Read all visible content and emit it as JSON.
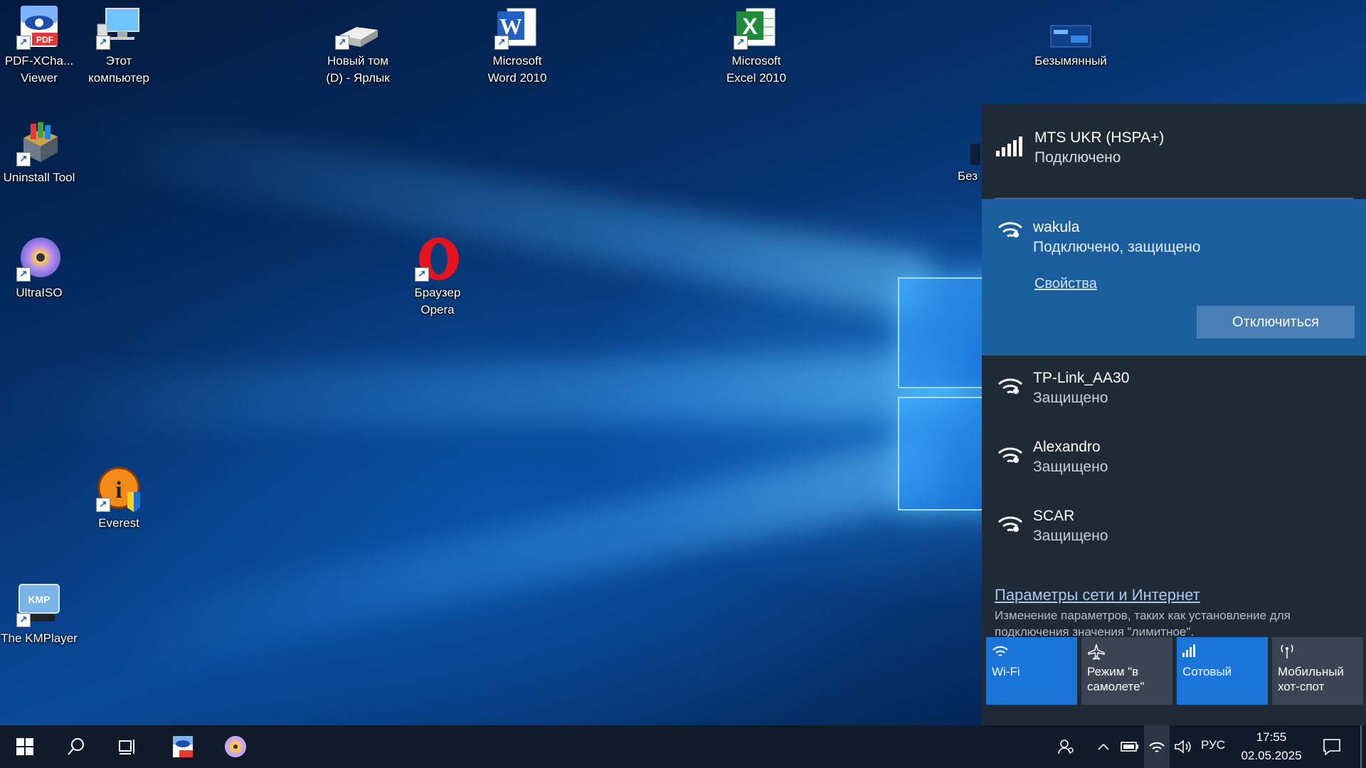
{
  "desktop": {
    "icons": [
      {
        "label": "PDF-XCha...\nViewer",
        "icon": "pdf-viewer-icon"
      },
      {
        "label": "Этот\nкомпьютер",
        "icon": "computer-icon"
      },
      {
        "label": "Новый том\n(D) - Ярлык",
        "icon": "drive-icon"
      },
      {
        "label": "Microsoft\nWord 2010",
        "icon": "word-icon"
      },
      {
        "label": "Microsoft\nExcel 2010",
        "icon": "excel-icon"
      },
      {
        "label": "Безымянный",
        "icon": "image-file-icon"
      },
      {
        "label": "Uninstall Tool",
        "icon": "uninstall-icon"
      },
      {
        "label": "Без",
        "icon": "file-icon"
      },
      {
        "label": "UltraISO",
        "icon": "disc-icon"
      },
      {
        "label": "Браузер\nOpera",
        "icon": "opera-icon"
      },
      {
        "label": "Everest",
        "icon": "everest-icon"
      },
      {
        "label": "The KMPlayer",
        "icon": "kmplayer-icon"
      }
    ]
  },
  "network": {
    "cellular": {
      "name": "MTS UKR (HSPA+)",
      "status": "Подключено"
    },
    "wifi_connected": {
      "name": "wakula",
      "status": "Подключено, защищено",
      "properties_label": "Свойства",
      "disconnect_label": "Отключиться"
    },
    "wifi_networks": [
      {
        "name": "TP-Link_AA30",
        "status": "Защищено"
      },
      {
        "name": "Alexandro",
        "status": "Защищено"
      },
      {
        "name": "SCAR",
        "status": "Защищено"
      }
    ],
    "settings_link": "Параметры сети и Интернет",
    "settings_desc": "Изменение параметров, таких как установление для подключения значения \"лимитное\".",
    "quick_actions": [
      {
        "label": "Wi-Fi",
        "state": "on",
        "icon": "wifi-icon"
      },
      {
        "label": "Режим \"в самолете\"",
        "state": "off",
        "icon": "airplane-icon"
      },
      {
        "label": "Сотовый",
        "state": "on",
        "icon": "cellular-icon"
      },
      {
        "label": "Мобильный хот-спот",
        "state": "off",
        "icon": "hotspot-icon"
      }
    ]
  },
  "taskbar": {
    "language": "РУС",
    "time": "17:55",
    "date": "02.05.2025"
  },
  "colors": {
    "accent": "#1b74d8",
    "flyout_bg": "#1f2a37",
    "active_network_bg": "#1b5e9e",
    "taskbar_bg": "#101b2a"
  }
}
